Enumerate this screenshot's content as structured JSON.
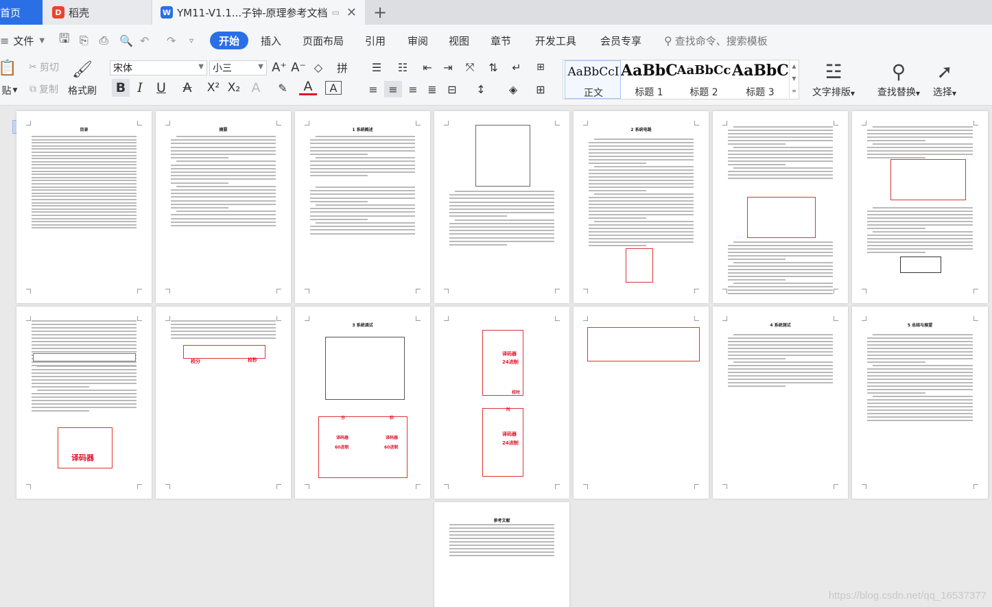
{
  "tabs": {
    "home": "首页",
    "daoke": "稻壳",
    "doc": "YM11-V1.1...子钟-原理参考文档"
  },
  "menu": {
    "file": "文件",
    "items": [
      "开始",
      "插入",
      "页面布局",
      "引用",
      "审阅",
      "视图",
      "章节",
      "开发工具",
      "会员专享"
    ],
    "search": "查找命令、搜索模板"
  },
  "ribbon": {
    "paste": "贴",
    "cut": "剪切",
    "copy": "复制",
    "format_painter": "格式刷",
    "font_name": "宋体",
    "font_size": "小三",
    "styles": [
      {
        "preview": "AaBbCcI",
        "label": "正文"
      },
      {
        "preview": "AaBbC",
        "label": "标题 1"
      },
      {
        "preview": "AaBbCc",
        "label": "标题 2"
      },
      {
        "preview": "AaBbC",
        "label": "标题 3"
      }
    ],
    "text_layout": "文字排版",
    "find_replace": "查找替换",
    "select": "选择"
  },
  "pages": {
    "p1_title": "目录",
    "p2_title": "摘要",
    "p3_title": "1 系统概述",
    "p5_title": "2 系统电路",
    "p10_title": "3 系统调试",
    "p18_title": "4 系统测试",
    "p19_title": "5 总结与展望",
    "p21_title": "参考文献",
    "labels": {
      "jiaoma1": "译码器",
      "jiaomiao": "校秒",
      "jiaofen": "校分",
      "yimaqi": "译码器",
      "jinzhi60": "60进制",
      "jinzhi24": "24进制",
      "jiaoshi": "校时",
      "fen": "分",
      "miao": "秒",
      "shi": "时"
    }
  },
  "watermark": "https://blog.csdn.net/qq_16537377"
}
